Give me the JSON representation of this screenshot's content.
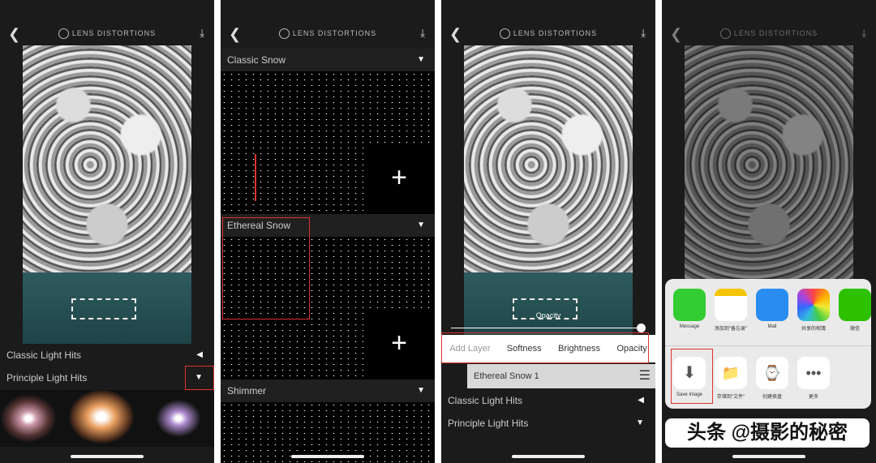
{
  "header": {
    "logo": "LENS DISTORTIONS"
  },
  "panel1": {
    "rows": [
      "Classic Light Hits",
      "Principle Light Hits"
    ]
  },
  "panel2": {
    "sections": [
      "Classic Snow",
      "Ethereal Snow",
      "Shimmer"
    ]
  },
  "panel3": {
    "slider_label": "Opacity",
    "tabs": [
      "Add Layer",
      "Softness",
      "Brightness",
      "Opacity"
    ],
    "layer": "Ethereal Snow 1",
    "rows": [
      "Classic Light Hits",
      "Principle Light Hits"
    ]
  },
  "panel4": {
    "apps": [
      "Message",
      "添加到\"备忘录\"",
      "Mail",
      "共享的相簿",
      "微信"
    ],
    "actions": [
      "Save Image",
      "存储到\"文件\"",
      "创建表盘",
      "更多"
    ],
    "watermark": "头条 @摄影的秘密"
  },
  "colors": {
    "highlight": "#d33333",
    "accent": "#1b1b1b"
  }
}
